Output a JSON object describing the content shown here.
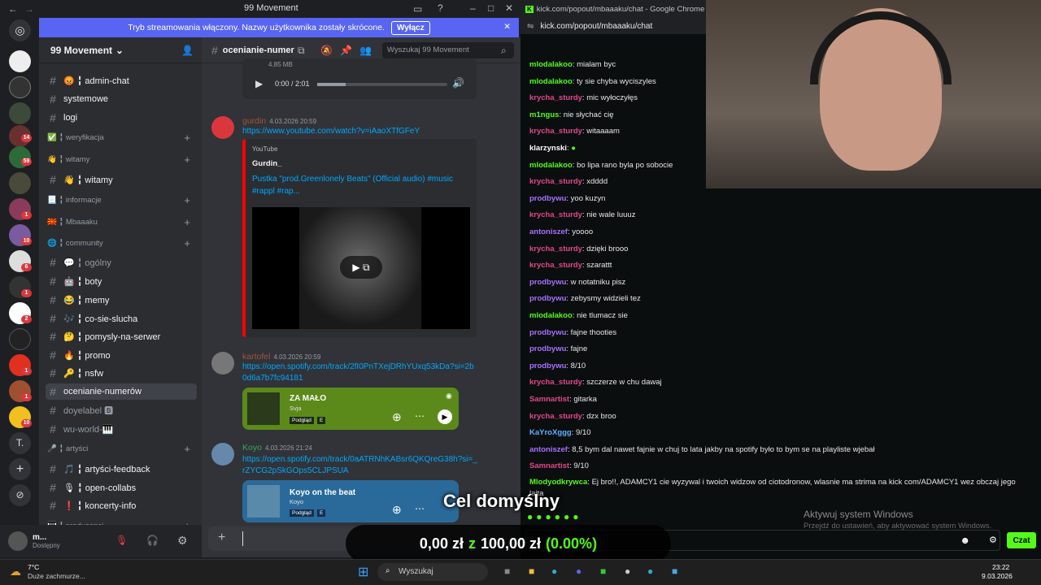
{
  "discord": {
    "window_title": "99 Movement",
    "banner_text": "Tryb streamowania włączony. Nazwy użytkownika zostały skrócone.",
    "banner_button": "Wyłącz",
    "server_name": "99 Movement",
    "channel_name": "ocenianie-numer",
    "search_placeholder": "Wyszukaj 99 Movement",
    "sidebar_items": [
      {
        "kind": "ch",
        "label": "😡 ╏ admin-chat",
        "bold": true
      },
      {
        "kind": "ch",
        "label": "systemowe",
        "bold": true
      },
      {
        "kind": "ch",
        "label": "logi",
        "bold": true
      },
      {
        "kind": "cat",
        "label": "✅ ╏ weryfikacja"
      },
      {
        "kind": "cat",
        "label": "👋 ╏ witamy"
      },
      {
        "kind": "ch",
        "label": "👋 ╏ witamy",
        "bold": true
      },
      {
        "kind": "cat",
        "label": "📃 ╏ informacje"
      },
      {
        "kind": "cat",
        "label": "🇲🇰 ╏ Mbaaaku"
      },
      {
        "kind": "cat",
        "label": "🌐 ╏ community"
      },
      {
        "kind": "ch",
        "label": "💬 ╏ ogólny",
        "bold": false
      },
      {
        "kind": "ch",
        "label": "🤖 ╏ boty",
        "bold": true
      },
      {
        "kind": "ch",
        "label": "😂 ╏ memy",
        "bold": true
      },
      {
        "kind": "ch",
        "label": "🎶 ╏ co-sie-slucha",
        "bold": true
      },
      {
        "kind": "ch",
        "label": "🤔 ╏ pomysly-na-serwer",
        "bold": true
      },
      {
        "kind": "ch",
        "label": "🔥 ╏ promo",
        "bold": true
      },
      {
        "kind": "ch",
        "label": "🔑 ╏ nsfw",
        "bold": true
      },
      {
        "kind": "ch",
        "label": "ocenianie-numerów",
        "bold": true,
        "selected": true
      },
      {
        "kind": "ch",
        "label": "doyelabel 🅱",
        "bold": false
      },
      {
        "kind": "ch",
        "label": "wu-world-🎹",
        "bold": false
      },
      {
        "kind": "cat",
        "label": "🎤 ╏ artyści"
      },
      {
        "kind": "ch",
        "label": "🎵 ╏ artyści-feedback",
        "bold": true
      },
      {
        "kind": "ch",
        "label": "🎙 ╏ open-collabs",
        "bold": true
      },
      {
        "kind": "ch",
        "label": "❗ ╏ koncerty-info",
        "bold": true
      },
      {
        "kind": "cat",
        "label": "🎹 ╏ producenci"
      }
    ],
    "user": {
      "name": "m...",
      "status": "Dostępny"
    },
    "audio": {
      "size": "4.85 MB",
      "time": "0:00 / 2:01"
    },
    "messages": [
      {
        "user": "gurdin",
        "time": "4.03.2026 20:59",
        "link": "https://www.youtube.com/watch?v=iAaoXTfGFeY",
        "provider": "YouTube",
        "author": "Gurdin_",
        "title": "Pustka \"prod.Greenlonely Beats\" (Official audio) #music #rappl #rap..."
      },
      {
        "user": "kartofel",
        "time": "4.03.2026 20:59",
        "link": "https://open.spotify.com/track/2fI0PnTXejDRhYUxq53kDa?si=2b0d6a7b7fc94181",
        "track": "ZA MAŁO",
        "artist": "Svja",
        "preview": "Podgląd",
        "explicit": "E"
      },
      {
        "user": "Koyo",
        "time": "4.03.2026 21:24",
        "link": "https://open.spotify.com/track/0aATRNhKABsr6QKQreG38h?si=_rZYCG2pSkGOps5CLJPSUA",
        "track": "Koyo on the beat",
        "artist": "Koyo",
        "preview": "Podgląd",
        "explicit": "E"
      }
    ]
  },
  "kick": {
    "window_title": "kick.com/popout/mbaaaku/chat - Google Chrome",
    "url": "kick.com/popout/mbaaaku/chat",
    "messages": [
      {
        "u": "mlodalakoo",
        "c": "#53fc18",
        "t": "mialam byc"
      },
      {
        "u": "mlodalakoo",
        "c": "#53fc18",
        "t": "ty sie chyba wyciszyles"
      },
      {
        "u": "krycha_sturdy",
        "c": "#e2468d",
        "t": "mic wyłoczyłęs"
      },
      {
        "u": "m1ngus",
        "c": "#53fc18",
        "t": "nie słychać cię"
      },
      {
        "u": "krycha_sturdy",
        "c": "#e2468d",
        "t": "witaaaam"
      },
      {
        "u": "klarzynski",
        "c": "#fff",
        "t": ""
      },
      {
        "u": "mlodalakoo",
        "c": "#53fc18",
        "t": "bo lipa rano byla po sobocie"
      },
      {
        "u": "krycha_sturdy",
        "c": "#e2468d",
        "t": "xdddd"
      },
      {
        "u": "prodbywu",
        "c": "#a970ff",
        "t": "yoo kuzyn"
      },
      {
        "u": "krycha_sturdy",
        "c": "#e2468d",
        "t": "nie wale luuuz"
      },
      {
        "u": "antoniszef",
        "c": "#a970ff",
        "t": "yoooo"
      },
      {
        "u": "krycha_sturdy",
        "c": "#e2468d",
        "t": "dzięki brooo"
      },
      {
        "u": "krycha_sturdy",
        "c": "#e2468d",
        "t": "szarattt"
      },
      {
        "u": "prodbywu",
        "c": "#a970ff",
        "t": "w notatniku pisz"
      },
      {
        "u": "prodbywu",
        "c": "#a970ff",
        "t": "zebysmy widzieli tez"
      },
      {
        "u": "mlodalakoo",
        "c": "#53fc18",
        "t": "nie tlumacz sie"
      },
      {
        "u": "prodbywu",
        "c": "#a970ff",
        "t": "fajne thooties"
      },
      {
        "u": "prodbywu",
        "c": "#a970ff",
        "t": "fajne"
      },
      {
        "u": "prodbywu",
        "c": "#a970ff",
        "t": "8/10"
      },
      {
        "u": "krycha_sturdy",
        "c": "#e2468d",
        "t": "szczerze w chu dawaj"
      },
      {
        "u": "Samnartist",
        "c": "#e2468d",
        "t": "gitarka"
      },
      {
        "u": "krycha_sturdy",
        "c": "#e2468d",
        "t": "dzx broo"
      },
      {
        "u": "KaYroXggg",
        "c": "#5cb3ff",
        "t": "9/10"
      },
      {
        "u": "antoniszef",
        "c": "#a970ff",
        "t": "8,5 bym dal nawet fajnie w chuj to lata jakby na spotify było to bym se na playliste wjebał"
      },
      {
        "u": "Samnartist",
        "c": "#e2468d",
        "t": "9/10"
      },
      {
        "u": "Mlodyodkrywca",
        "c": "#53fc18",
        "t": "Ej bro!!, ADAMCY1 cie wyzywal i twoich widzow od ciotodronow, wlasnie ma strima na kick com/ADAMCY1 wez obczaj jego lajta"
      }
    ],
    "send_button": "Czat",
    "watermark_title": "Aktywuj system Windows",
    "watermark_sub": "Przejdź do ustawień, aby aktywować system Windows."
  },
  "overlay": {
    "goal_title": "Cel domyślny",
    "amount": "0,00 zł",
    "z": "z",
    "target": "100,00 zł",
    "percent": "(0.00%)"
  },
  "taskbar": {
    "temp": "7°C",
    "weather": "Duże zachmurze...",
    "search": "Wyszukaj",
    "time": "23:22",
    "date": "9.03.2026"
  }
}
